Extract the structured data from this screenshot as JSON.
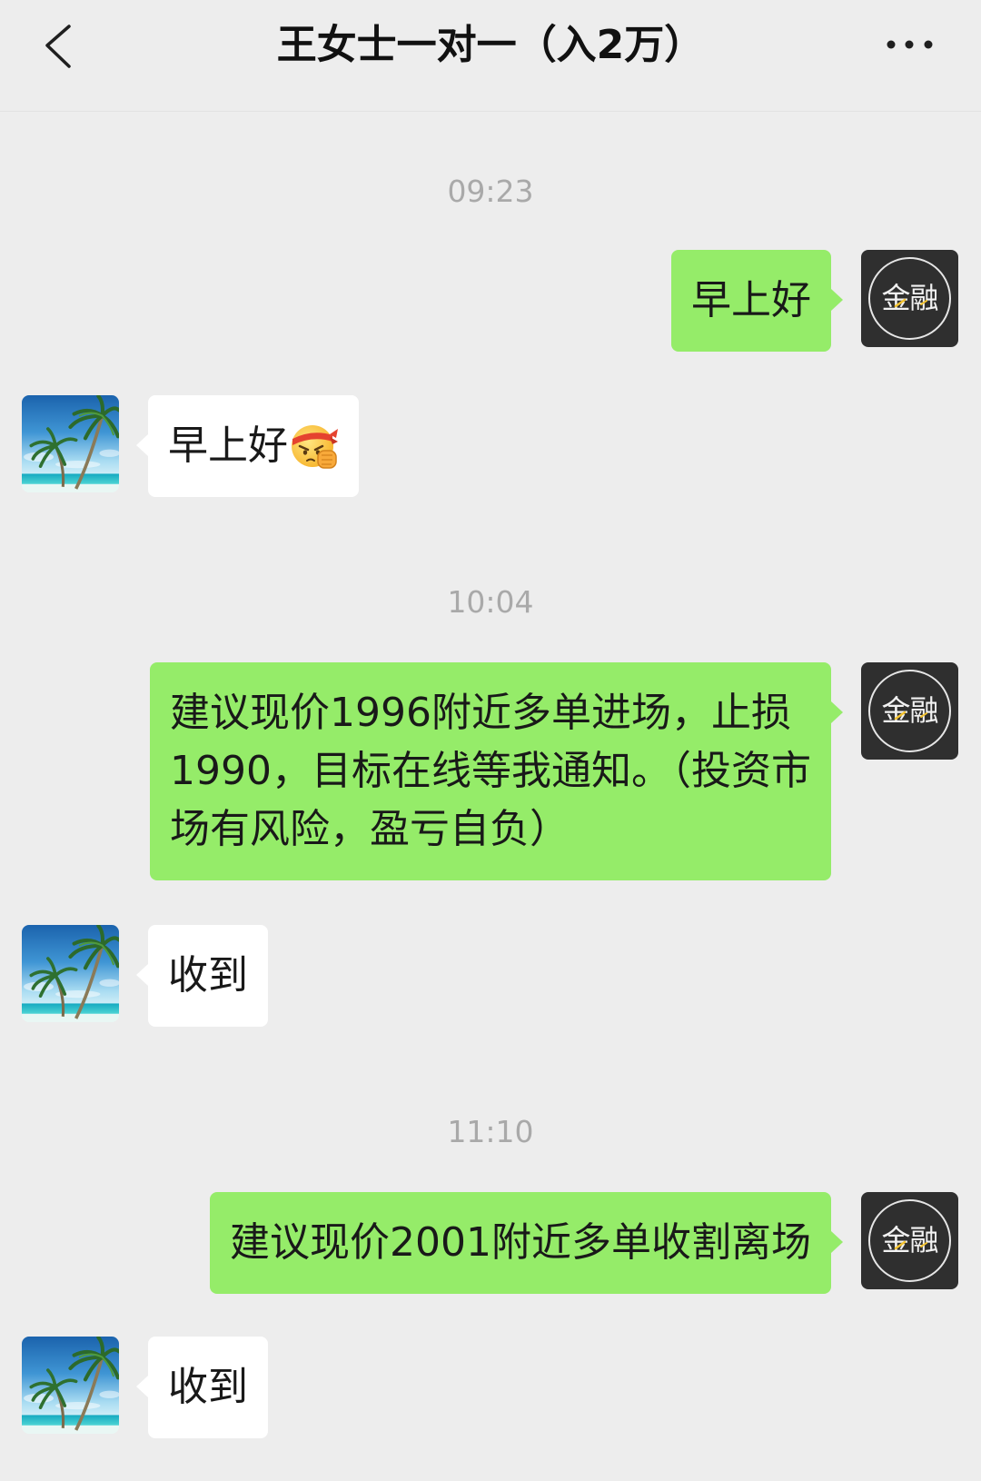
{
  "header": {
    "title": "王女士一对一（入2万）",
    "back_icon": "chevron-left-icon",
    "more_icon": "more-dots-icon"
  },
  "self_avatar": {
    "logo_text": "金融"
  },
  "chat": [
    {
      "time": "09:23"
    },
    {
      "outgoing": true,
      "text": "早上好"
    },
    {
      "outgoing": false,
      "text": "早上好",
      "emoji": "determined-face-emoji"
    },
    {
      "time": "10:04"
    },
    {
      "outgoing": true,
      "text": "建议现价1996附近多单进场，止损1990，目标在线等我通知。（投资市场有风险，盈亏自负）"
    },
    {
      "outgoing": false,
      "text": "收到"
    },
    {
      "time": "11:10"
    },
    {
      "outgoing": true,
      "text": "建议现价2001附近多单收割离场"
    },
    {
      "outgoing": false,
      "text": "收到"
    }
  ],
  "colors": {
    "background": "#ededed",
    "sent_bubble": "#95ec69",
    "received_bubble": "#ffffff",
    "timestamp": "#a9a9a9",
    "self_avatar_bg": "#2f2f2f"
  }
}
